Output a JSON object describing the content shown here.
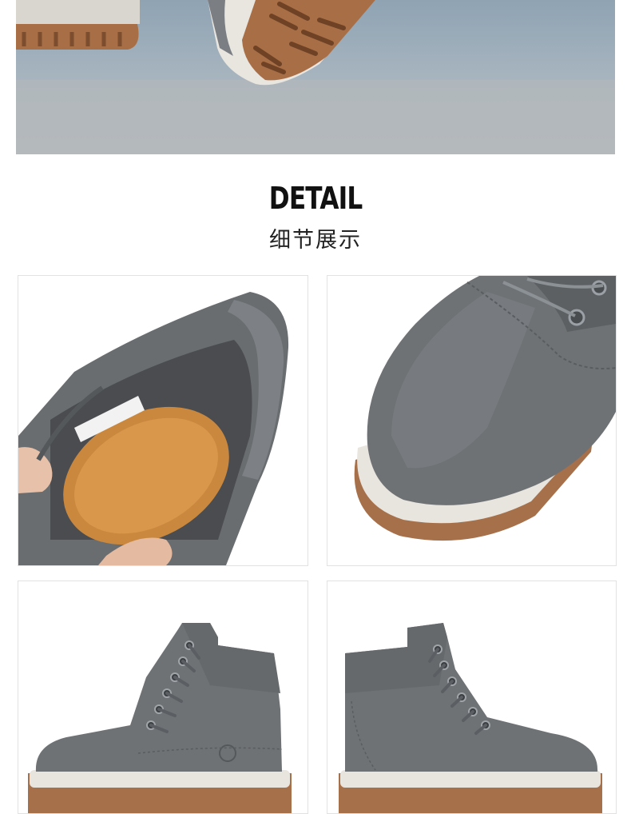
{
  "heading": {
    "title_en": "DETAIL",
    "title_zh": "细节展示"
  },
  "photos": [
    {
      "subject": "boot-on-floor"
    },
    {
      "subject": "boot-interior-insole"
    },
    {
      "subject": "boot-toe-closeup"
    },
    {
      "subject": "boot-side-view"
    },
    {
      "subject": "boot-side-view-back"
    }
  ],
  "colors": {
    "nubuck_gray": "#6f7275",
    "sole_gum": "#a6704a",
    "midsole_white": "#e8e4de",
    "insole_tan": "#c9883e"
  }
}
